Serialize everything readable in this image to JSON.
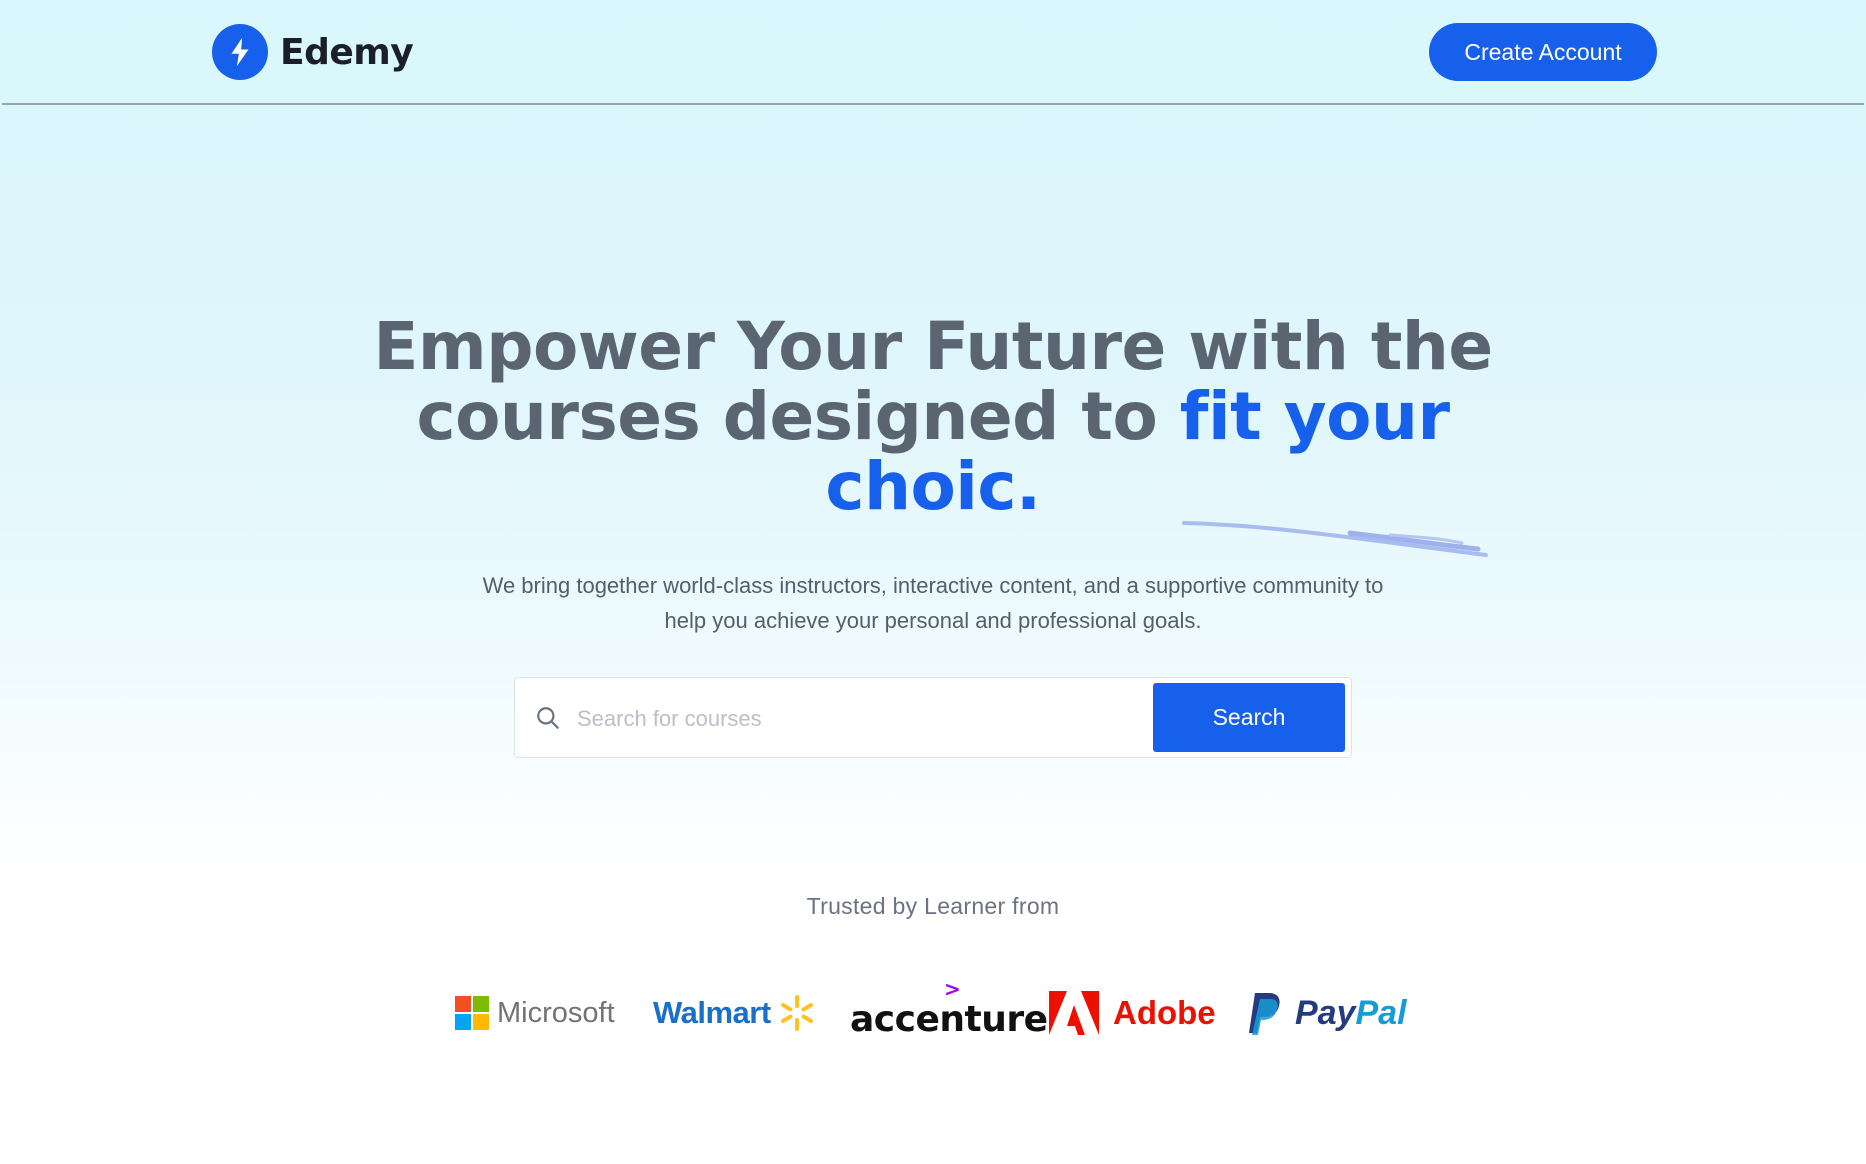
{
  "header": {
    "brand_name": "Edemy",
    "brand_icon": "lightning-bolt-icon",
    "create_account_label": "Create Account"
  },
  "hero": {
    "title_part1": "Empower Your Future with the courses designed to",
    "title_accent": "fit your choic.",
    "subtitle": "We bring together world-class instructors, interactive content, and a supportive community to help you achieve your personal and professional goals."
  },
  "search": {
    "placeholder": "Search for courses",
    "value": "",
    "button_label": "Search",
    "icon": "search-icon"
  },
  "trusted": {
    "label": "Trusted by Learner from",
    "logos": [
      {
        "name": "Microsoft"
      },
      {
        "name": "Walmart"
      },
      {
        "name": "accenture",
        "mark": ">"
      },
      {
        "name": "Adobe"
      },
      {
        "name_part1": "Pay",
        "name_part2": "Pal"
      }
    ]
  },
  "colors": {
    "accent": "#1760ec",
    "heading": "#5b6471",
    "body_text": "#555e69"
  }
}
